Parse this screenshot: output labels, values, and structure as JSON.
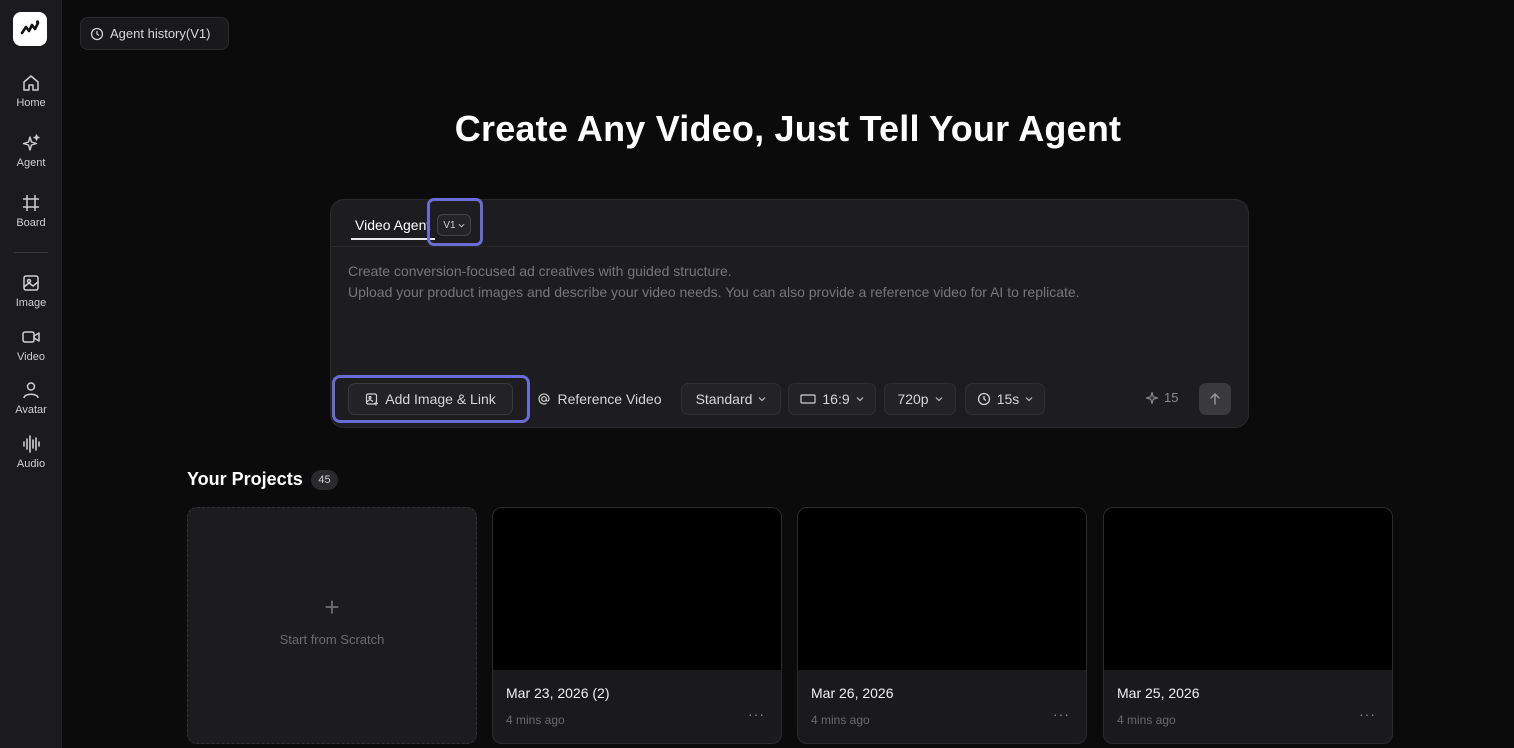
{
  "sidebar": {
    "items": [
      {
        "label": "Home",
        "icon": "home-icon"
      },
      {
        "label": "Agent",
        "icon": "sparkles-icon"
      },
      {
        "label": "Board",
        "icon": "frame-icon"
      },
      {
        "label": "Image",
        "icon": "image-icon"
      },
      {
        "label": "Video",
        "icon": "video-icon"
      },
      {
        "label": "Avatar",
        "icon": "user-icon"
      },
      {
        "label": "Audio",
        "icon": "audio-wave-icon"
      }
    ]
  },
  "header": {
    "history_label": "Agent history(V1)"
  },
  "hero": {
    "title": "Create Any Video, Just Tell Your Agent"
  },
  "composer": {
    "tab_label": "Video Agent",
    "version": "V1",
    "placeholder_lines": [
      "Create conversion-focused ad creatives with guided structure.",
      "Upload your product images and describe your video needs. You can also provide a reference video for AI to replicate."
    ],
    "toolbar": {
      "add_image": "Add Image & Link",
      "reference_video": "Reference Video",
      "quality": "Standard",
      "ratio": "16:9",
      "resolution": "720p",
      "duration": "15s",
      "credits": "15"
    }
  },
  "projects": {
    "title": "Your Projects",
    "count": "45",
    "new_label": "Start from Scratch",
    "items": [
      {
        "title": "Mar 23, 2026 (2)",
        "time": "4 mins ago"
      },
      {
        "title": "Mar 26, 2026",
        "time": "4 mins ago"
      },
      {
        "title": "Mar 25, 2026",
        "time": "4 mins ago"
      }
    ]
  },
  "colors": {
    "background": "#0b0b0c",
    "sidebar": "#1b1b1d",
    "highlight": "#6b6bd6"
  }
}
